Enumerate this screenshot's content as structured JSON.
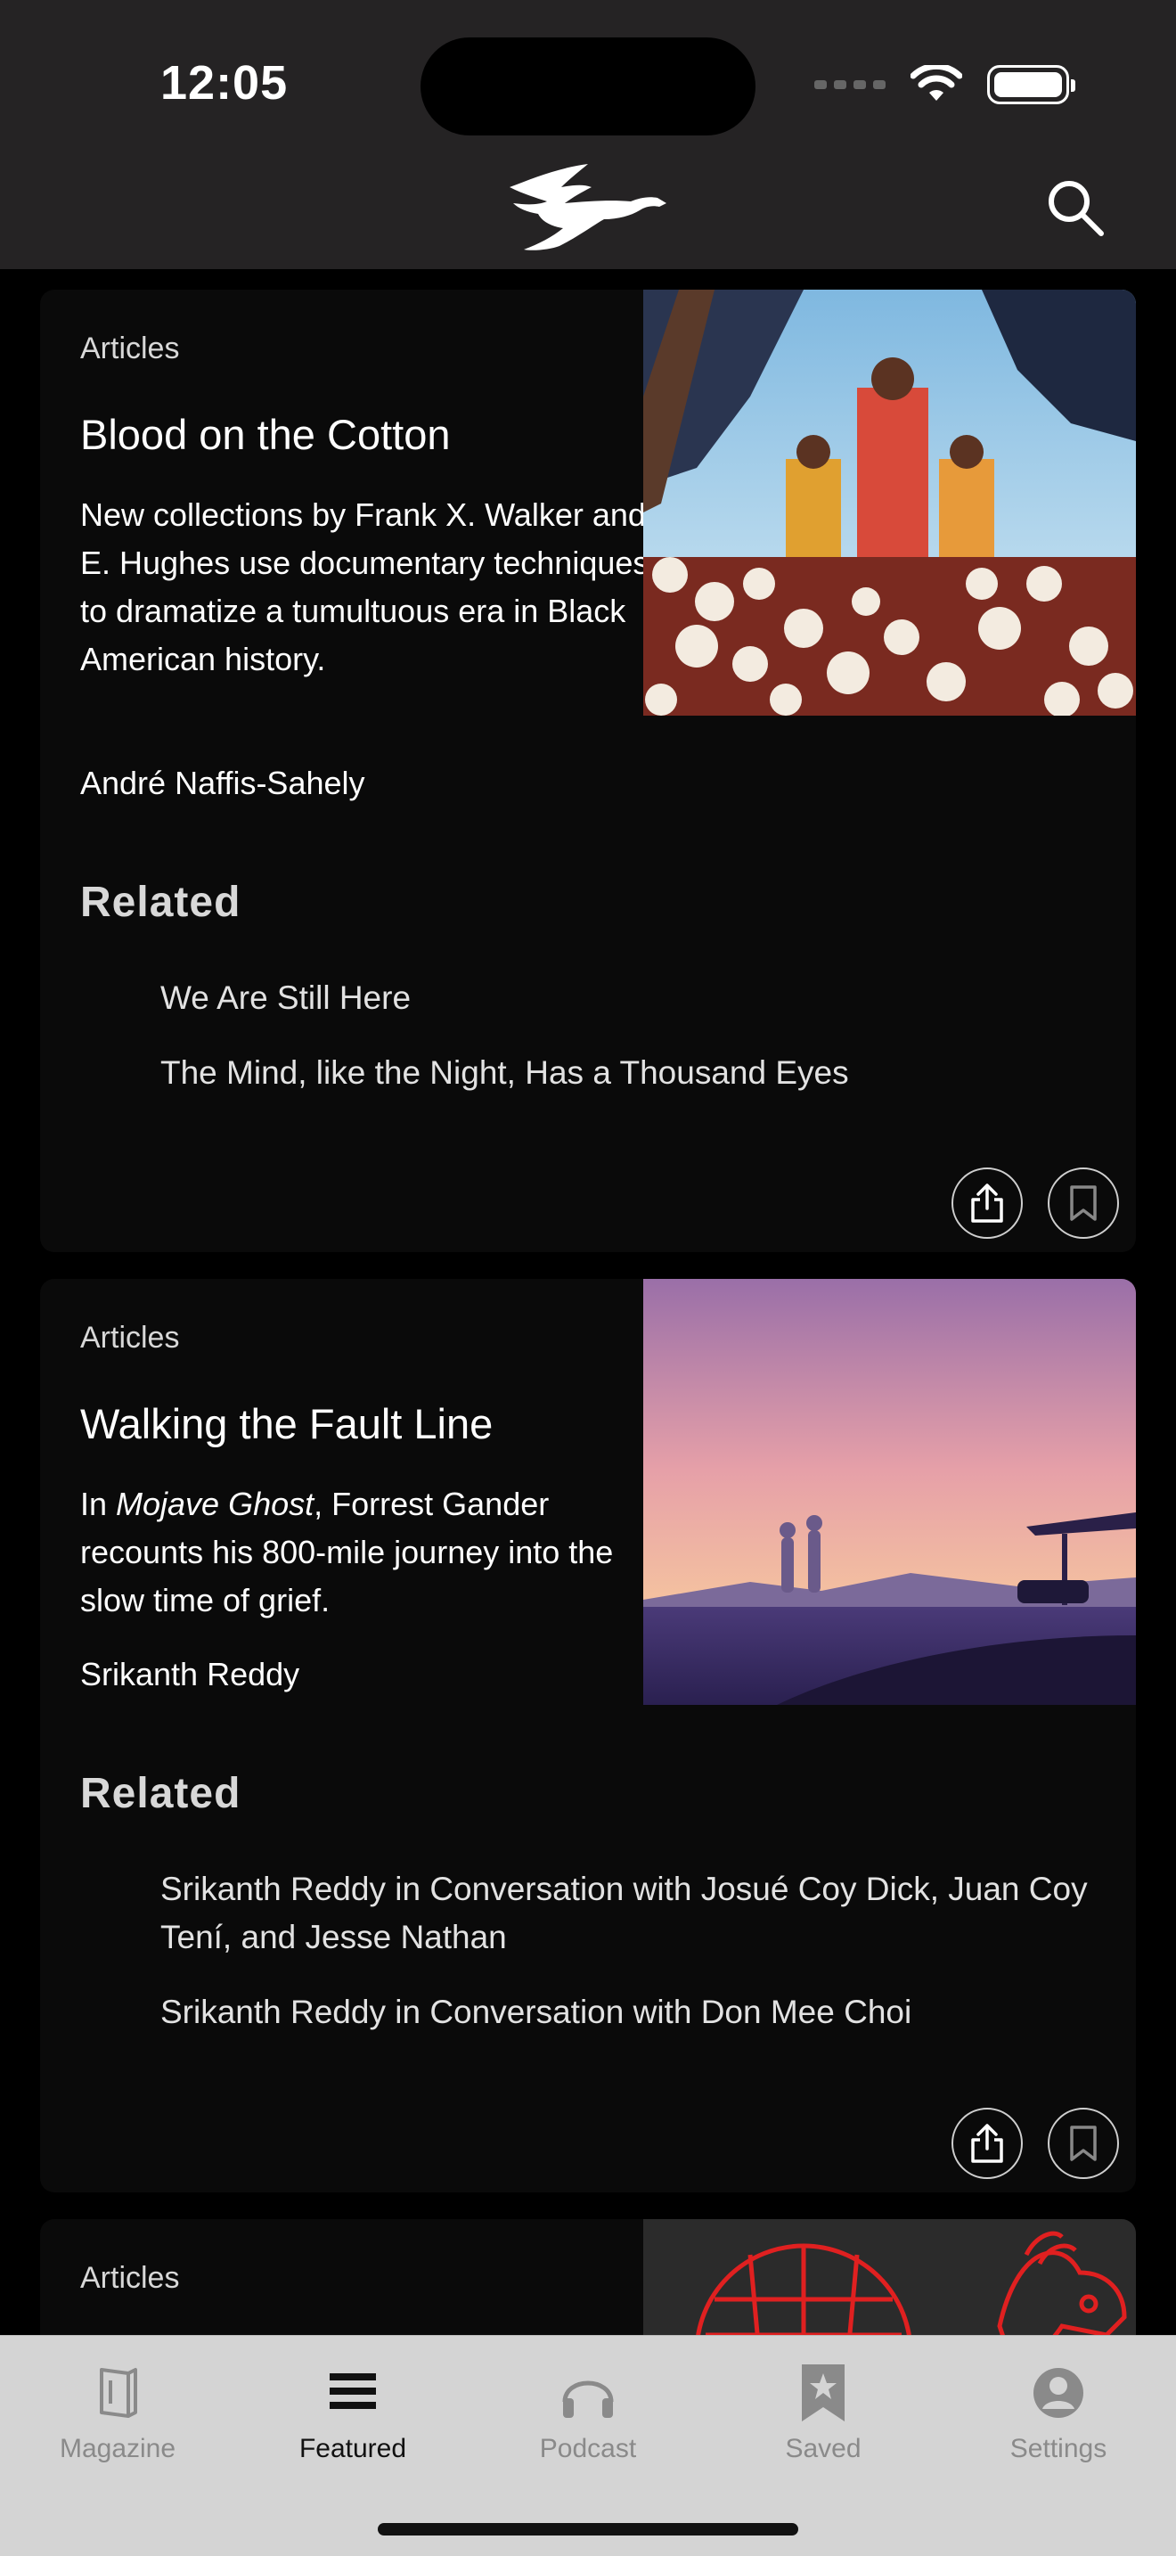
{
  "status": {
    "time": "12:05"
  },
  "header": {
    "logo_icon": "pegasus-logo-icon",
    "search_icon": "search-icon"
  },
  "cards": [
    {
      "category": "Articles",
      "title": "Blood on the Cotton",
      "description": "New collections by Frank X. Walker and E. Hughes use documentary techniques to dramatize a tumultuous era in Black American history.",
      "author": "André Naffis-Sahely",
      "related_heading": "Related",
      "related": [
        "We Are Still Here",
        "The Mind, like the Night, Has a Thousand Eyes"
      ]
    },
    {
      "category": "Articles",
      "title": "Walking the Fault Line",
      "description_pre": "In ",
      "description_italic": "Mojave Ghost",
      "description_post": ", Forrest Gander recounts his 800-mile journey into the slow time of grief.",
      "author": "Srikanth Reddy",
      "related_heading": "Related",
      "related": [
        "Srikanth Reddy in Conversation with Josué Coy Dick, Juan Coy Tení, and Jesse Nathan",
        "Srikanth Reddy in Conversation with Don Mee Choi"
      ]
    },
    {
      "category": "Articles"
    }
  ],
  "tabs": [
    {
      "label": "Magazine",
      "icon": "book-icon"
    },
    {
      "label": "Featured",
      "icon": "stack-icon",
      "active": true
    },
    {
      "label": "Podcast",
      "icon": "headphones-icon"
    },
    {
      "label": "Saved",
      "icon": "bookmark-star-icon"
    },
    {
      "label": "Settings",
      "icon": "person-icon"
    }
  ]
}
